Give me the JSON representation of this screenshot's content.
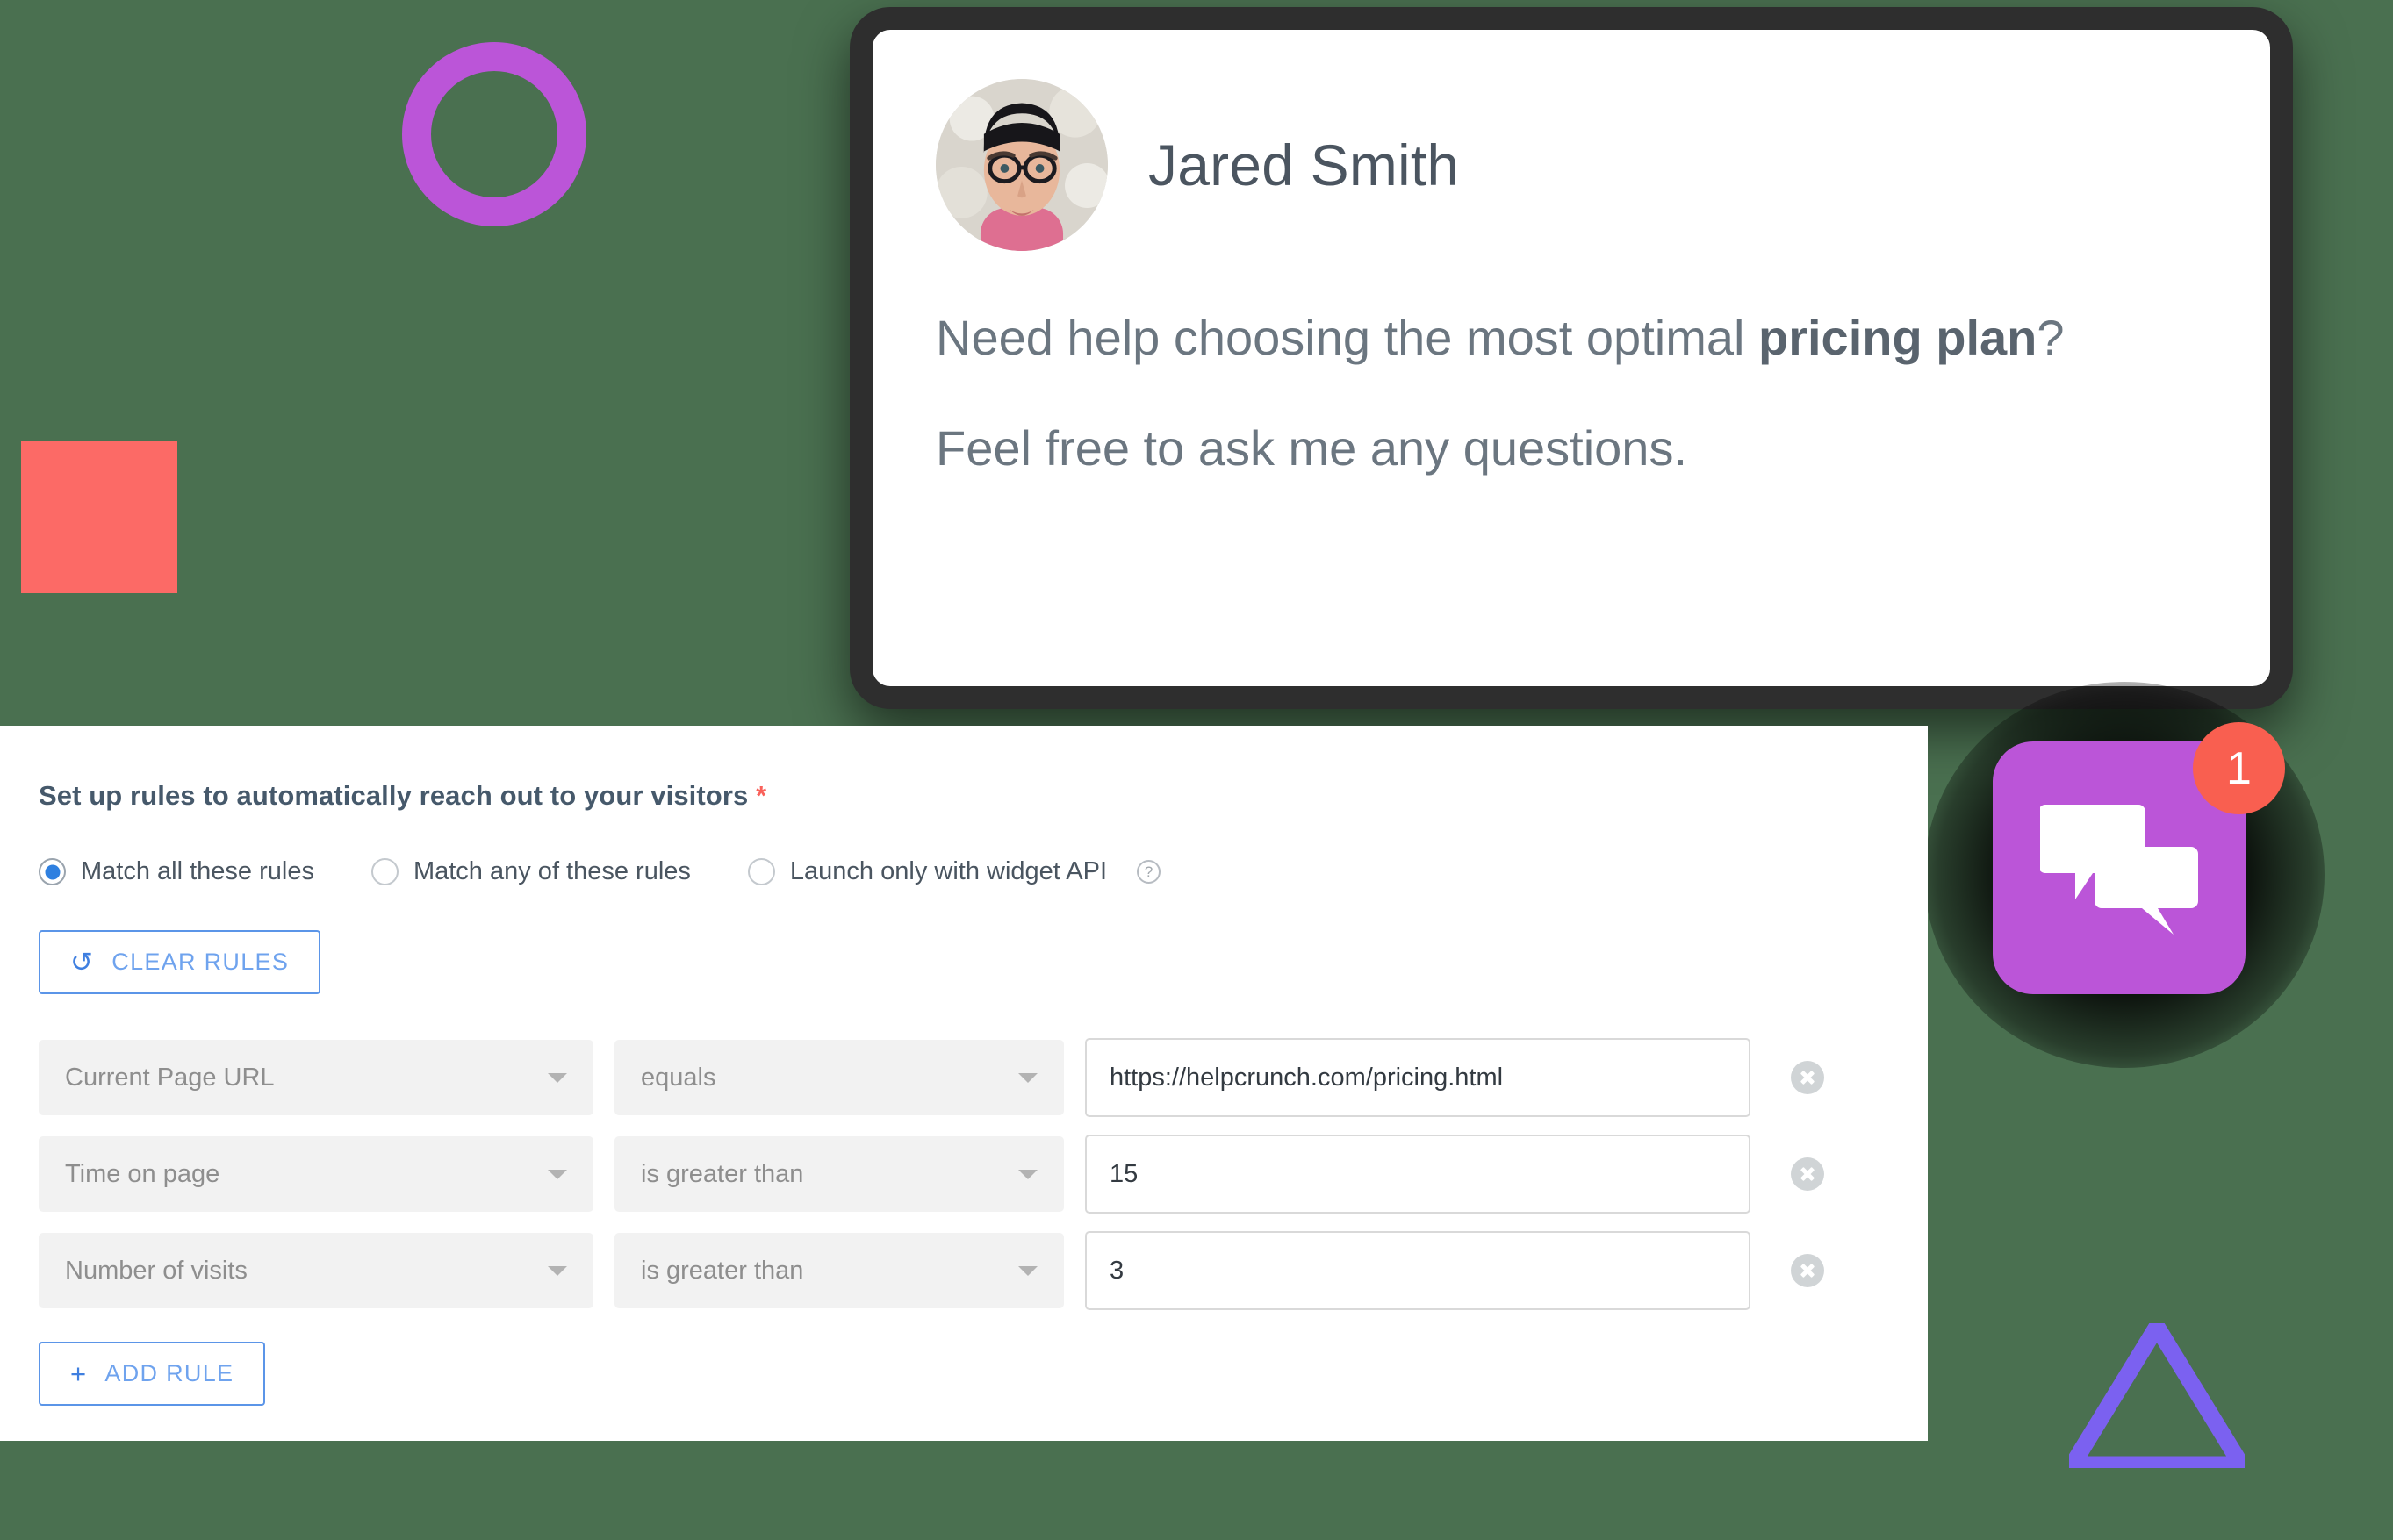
{
  "theme": {
    "background": "#4a7050",
    "accent_purple": "#bb55d8",
    "accent_red": "#fc6a66",
    "accent_indigo": "#7b61f0",
    "badge_red": "#f95f50",
    "link_blue": "#5b95e8",
    "radio_selected": "#2f80e0"
  },
  "decorations": {
    "ring": "purple-ring-shape",
    "square": "red-square-shape",
    "triangle": "indigo-triangle-outline-shape"
  },
  "chat_preview": {
    "agent_name": "Jared Smith",
    "avatar": "agent-photo",
    "message_line1_prefix": "Need help choosing the most optimal ",
    "message_line1_strong": "pricing plan",
    "message_line1_suffix": "?",
    "message_line2": "Feel free to ask me any questions."
  },
  "launcher": {
    "icon": "chat-bubbles-icon",
    "badge_count": "1"
  },
  "rules_panel": {
    "title": "Set up rules to automatically reach out to your visitors",
    "required_marker": "*",
    "match_options": [
      {
        "label": "Match all these rules",
        "selected": true,
        "has_help": false
      },
      {
        "label": "Match any of these rules",
        "selected": false,
        "has_help": false
      },
      {
        "label": "Launch only with widget API",
        "selected": false,
        "has_help": true
      }
    ],
    "help_glyph": "?",
    "clear_rules": {
      "label": "CLEAR RULES",
      "icon": "undo-icon",
      "glyph": "↺"
    },
    "add_rule": {
      "label": "ADD RULE",
      "icon": "plus-icon",
      "glyph": "+"
    },
    "rules": [
      {
        "field": "Current Page URL",
        "operator": "equals",
        "value": "https://helpcrunch.com/pricing.html",
        "remove": "remove-rule-icon"
      },
      {
        "field": "Time on page",
        "operator": "is greater than",
        "value": "15",
        "remove": "remove-rule-icon"
      },
      {
        "field": "Number of visits",
        "operator": "is greater than",
        "value": "3",
        "remove": "remove-rule-icon"
      }
    ]
  }
}
